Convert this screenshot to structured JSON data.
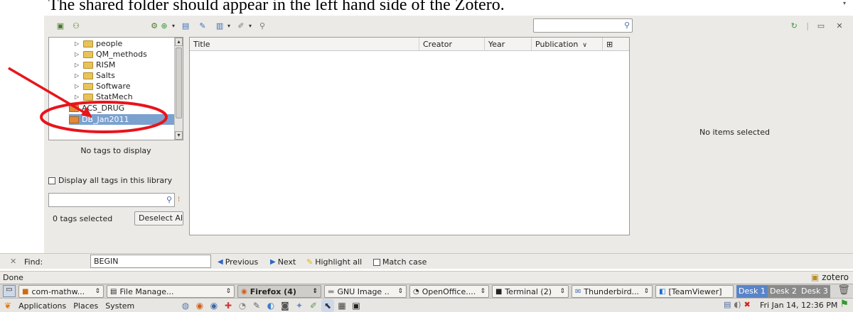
{
  "caption": "The shared folder should appear in the left hand side of the Zotero.",
  "toolbar": {
    "left_icons": [
      "new-collection-icon",
      "new-group-icon"
    ],
    "actions_icon": "gear-icon",
    "item_icons": [
      "new-item-icon",
      "new-note-icon",
      "add-attachment-icon",
      "link-icon",
      "search-icon"
    ],
    "search_value": "",
    "right_icons": [
      "sync-icon",
      "fullscreen-icon",
      "close-icon"
    ]
  },
  "collections": [
    {
      "label": "people",
      "type": "folder"
    },
    {
      "label": "QM_methods",
      "type": "folder"
    },
    {
      "label": "RISM",
      "type": "folder"
    },
    {
      "label": "Salts",
      "type": "folder"
    },
    {
      "label": "Software",
      "type": "folder"
    },
    {
      "label": "StatMech",
      "type": "folder"
    },
    {
      "label": "ACS_DRUG",
      "type": "library"
    },
    {
      "label": "DB_Jan2011",
      "type": "library",
      "selected": true
    }
  ],
  "tags": {
    "empty_text": "No tags to display",
    "display_all_label": "Display all tags in this library",
    "filter_value": "",
    "selected_count": "0 tags selected",
    "deselect_label": "Deselect All"
  },
  "items": {
    "columns": [
      "Title",
      "Creator",
      "Year",
      "Publication"
    ],
    "rows": []
  },
  "item_pane": {
    "empty_text": "No items selected"
  },
  "findbar": {
    "label": "Find:",
    "value": "BEGIN",
    "previous": "Previous",
    "next": "Next",
    "highlight": "Highlight all",
    "match_case": "Match case"
  },
  "statusbar": {
    "status": "Done",
    "zotero_label": "zotero"
  },
  "taskbar": {
    "tasks": [
      {
        "label": "com-mathw...",
        "icon": "terminal-icon"
      },
      {
        "label": "File Manage...",
        "icon": "file-manager-icon"
      },
      {
        "label": "Firefox (4)",
        "icon": "firefox-icon",
        "active": true
      },
      {
        "label": "GNU Image ..",
        "icon": "gimp-icon"
      },
      {
        "label": "OpenOffice....",
        "icon": "openoffice-icon"
      },
      {
        "label": "Terminal (2)",
        "icon": "terminal-icon"
      },
      {
        "label": "Thunderbird...",
        "icon": "thunderbird-icon"
      },
      {
        "label": "[TeamViewer]",
        "icon": "teamviewer-icon"
      }
    ],
    "desks": [
      "Desk 1",
      "Desk 2",
      "Desk 3"
    ]
  },
  "panel": {
    "menus": [
      "Applications",
      "Places",
      "System"
    ],
    "clock": "Fri Jan 14, 12:36 PM"
  },
  "colors": {
    "selection": "#7ba1cf",
    "annotation": "#e8141b",
    "window_bg": "#eceae6"
  }
}
